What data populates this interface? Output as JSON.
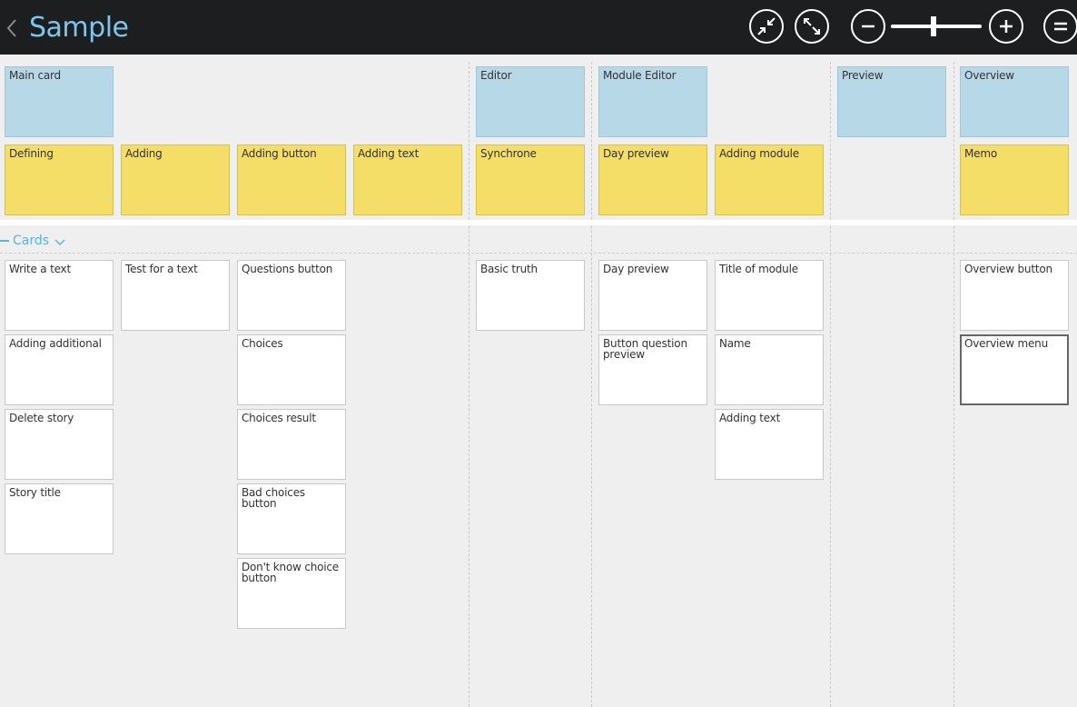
{
  "header": {
    "title": "Sample",
    "icons": {
      "back": "chevron-left-icon",
      "collapse": "collapse-arrows-icon",
      "expand": "expand-arrows-icon",
      "zoom_out": "minus-icon",
      "zoom_in": "plus-icon",
      "menu": "menu-icon"
    },
    "zoom_level": 0.47
  },
  "colors": {
    "topbar": "#1d1e20",
    "title": "#7cc6ee",
    "activity_card": "#b7d8e7",
    "task_card": "#f4de67",
    "story_card": "#ffffff",
    "swimlane": "#58b5e3"
  },
  "activities": [
    "Main card",
    "Editor",
    "Module Editor",
    "Preview",
    "Overview"
  ],
  "tasks": [
    "Defining",
    "Adding",
    "Adding button",
    "Adding text",
    "Synchrone",
    "Day preview",
    "Adding module",
    "Memo"
  ],
  "release": {
    "label": "Cards",
    "icon": "chevron-down-icon"
  },
  "stories": [
    "Write a text",
    "Adding additional",
    "Delete story",
    "Story title",
    "Test for a text",
    "Questions button",
    "Choices",
    "Choices result",
    "Bad choices button",
    "Don't know choice button",
    "Basic truth",
    "Day preview",
    "Button question preview",
    "Title of module",
    "Name",
    "Adding text",
    "Overview button",
    "Overview menu"
  ]
}
